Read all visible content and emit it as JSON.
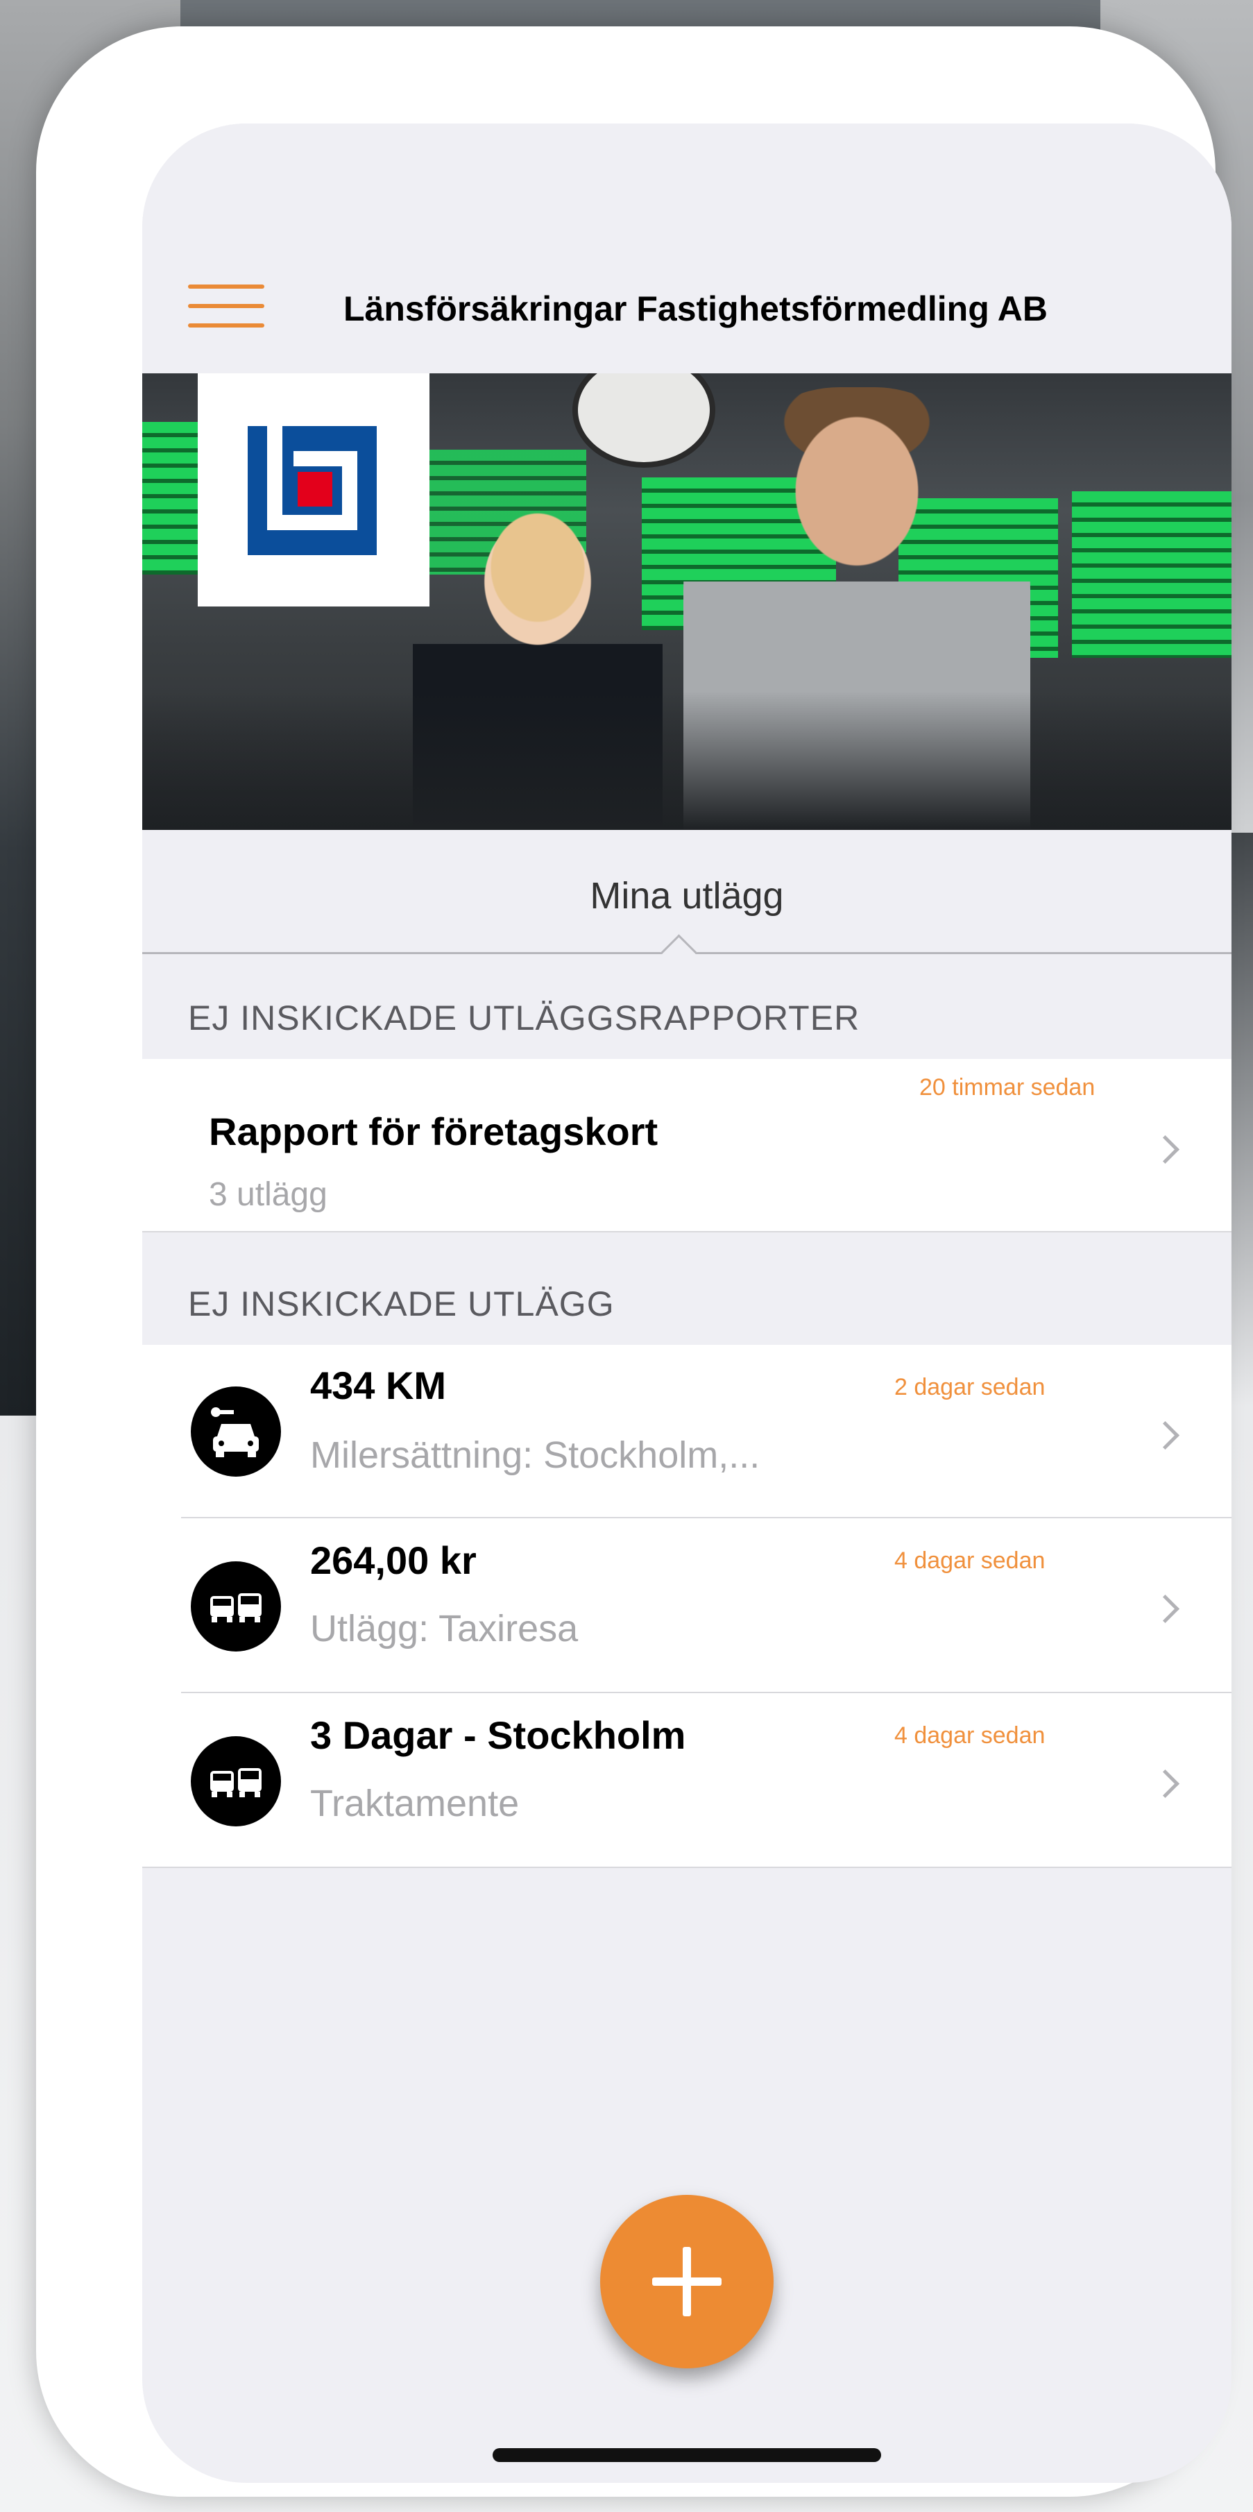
{
  "header": {
    "title": "Länsförsäkringar Fastighetsförmedling AB",
    "menu_icon": "hamburger-menu-icon"
  },
  "segment": {
    "label": "Mina utlägg"
  },
  "reports_section": {
    "header": "EJ INSKICKADE UTLÄGGSRAPPORTER",
    "items": [
      {
        "title": "Rapport för företagskort",
        "subtitle": "3 utlägg",
        "time": "20 timmar sedan"
      }
    ]
  },
  "expenses_section": {
    "header": "EJ INSKICKADE UTLÄGG",
    "items": [
      {
        "icon": "car-mileage-icon",
        "title": "434 KM",
        "subtitle": "Milersättning: Stockholm,...",
        "time": "2 dagar sedan"
      },
      {
        "icon": "vehicles-icon",
        "title": "264,00 kr",
        "subtitle": "Utlägg: Taxiresa",
        "time": "4 dagar sedan"
      },
      {
        "icon": "vehicles-icon",
        "title": "3 Dagar - Stockholm",
        "subtitle": "Traktamente",
        "time": "4 dagar sedan"
      }
    ]
  },
  "colors": {
    "accent": "#ED8B33",
    "logo_blue": "#0B4E9B",
    "logo_red": "#E3001B",
    "background": "#EFEFF4"
  },
  "fab": {
    "icon": "plus-icon"
  }
}
